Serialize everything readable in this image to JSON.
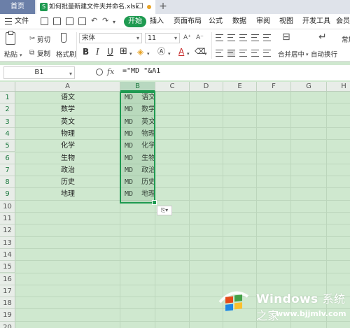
{
  "tabs": {
    "home_label": "首页",
    "file_label": "如何批量新建文件夹并命名.xlsx",
    "file_icon": "S",
    "add_label": "+"
  },
  "menu": {
    "file_label": "文件",
    "start_label": "开始",
    "items": [
      "插入",
      "页面布局",
      "公式",
      "数据",
      "审阅",
      "视图",
      "开发工具",
      "会员"
    ]
  },
  "ribbon": {
    "paste_label": "粘贴",
    "cut_label": "剪切",
    "copy_label": "复制",
    "format_painter_label": "格式刷",
    "font_name": "宋体",
    "font_size": "11",
    "merge_label": "合并居中",
    "wrap_label": "自动换行",
    "regular_label": "常规",
    "bold": "B",
    "italic": "I",
    "underline": "U",
    "font_color_glyph": "A",
    "grow_font": "A⁺",
    "shrink_font": "A⁻"
  },
  "formula": {
    "cell_ref": "B1",
    "fx": "fx",
    "content": "=\"MD \"&A1"
  },
  "columns": [
    "A",
    "B",
    "C",
    "D",
    "E",
    "F",
    "G",
    "H"
  ],
  "rows": [
    "1",
    "2",
    "3",
    "4",
    "5",
    "6",
    "7",
    "8",
    "9",
    "10",
    "11",
    "12",
    "13",
    "14",
    "15",
    "16",
    "17",
    "18",
    "19",
    "20"
  ],
  "col_a": [
    "语文",
    "数学",
    "英文",
    "物理",
    "化学",
    "生物",
    "政治",
    "历史",
    "地理"
  ],
  "col_b": [
    "MD  语文",
    "MD  数学",
    "MD  英文",
    "MD  物理",
    "MD  化学",
    "MD  生物",
    "MD  政治",
    "MD  历史",
    "MD  地理"
  ],
  "paste_options_label": "⎘▾",
  "watermark": {
    "brand": "Windows",
    "brand_cn": "系统之家",
    "url": "www.bjjmlv.com"
  },
  "colors": {
    "accent": "#1e9a50",
    "sheet_bg": "#cfe8cf",
    "home_tab": "#6b7fa8"
  }
}
